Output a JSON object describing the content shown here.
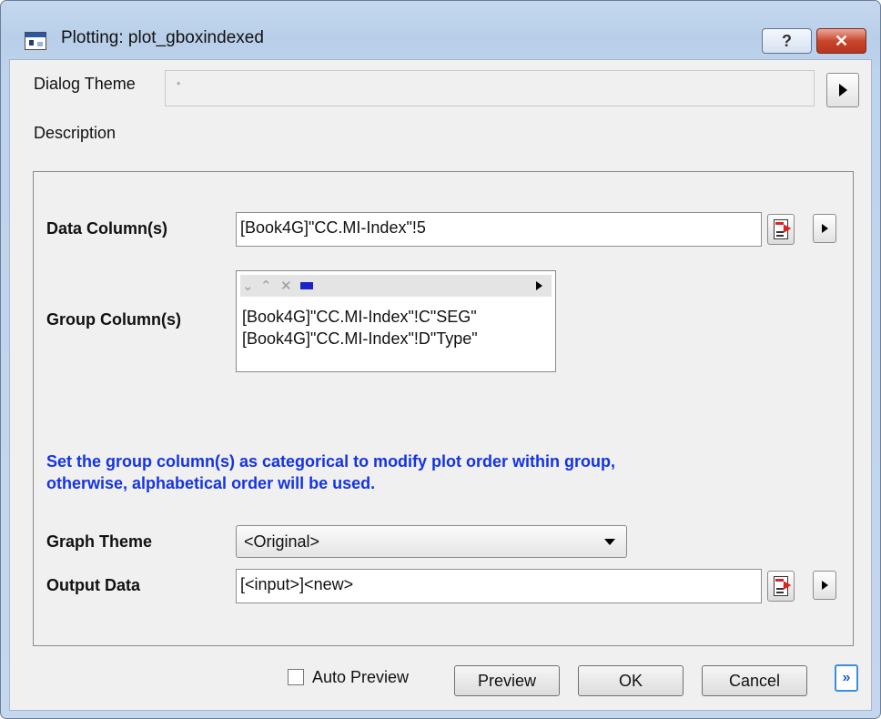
{
  "window": {
    "title": "Plotting: plot_gboxindexed",
    "help_label": "?",
    "close_label": "✕"
  },
  "dialog_theme": {
    "label": "Dialog Theme",
    "value": "*"
  },
  "description_label": "Description",
  "data_columns": {
    "label": "Data Column(s)",
    "value": "[Book4G]\"CC.MI-Index\"!5"
  },
  "group_columns": {
    "label": "Group Column(s)",
    "toolbar_icons": [
      "move-down-icon",
      "move-up-icon",
      "remove-icon",
      "select-icon",
      "menu-arrow-icon"
    ],
    "items": [
      "[Book4G]\"CC.MI-Index\"!C\"SEG\"",
      "[Book4G]\"CC.MI-Index\"!D\"Type\""
    ]
  },
  "info_text": {
    "line1": "Set the group column(s) as categorical to modify plot order within group,",
    "line2": "otherwise, alphabetical order will be used."
  },
  "graph_theme": {
    "label": "Graph Theme",
    "value": "<Original>"
  },
  "output_data": {
    "label": "Output Data",
    "value": "[<input>]<new>"
  },
  "buttons": {
    "auto_preview_label": "Auto Preview",
    "auto_preview_checked": false,
    "preview": "Preview",
    "ok": "OK",
    "cancel": "Cancel",
    "expand": "»"
  },
  "colors": {
    "info_text": "#1433e6",
    "title_bar": "#bed3ec",
    "accent": "#3b8fe0"
  }
}
